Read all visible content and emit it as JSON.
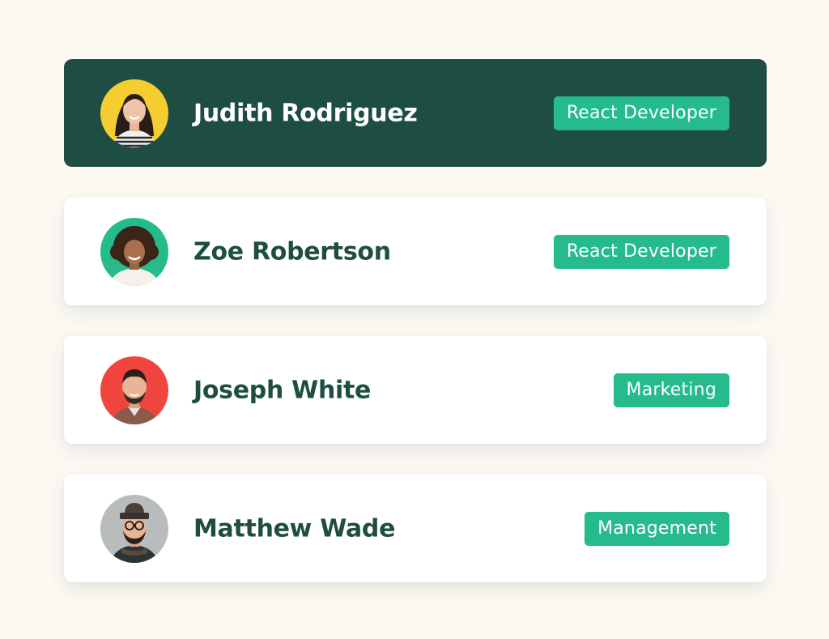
{
  "colors": {
    "background": "#fcf9f3",
    "active_card": "#1e4d42",
    "accent": "#25bb8c",
    "name_text": "#1e4d42"
  },
  "people": [
    {
      "name": "Judith Rodriguez",
      "role": "React Developer",
      "avatar_bg": "#f5cd30",
      "active": true
    },
    {
      "name": "Zoe Robertson",
      "role": "React Developer",
      "avatar_bg": "#25bb8c",
      "active": false
    },
    {
      "name": "Joseph White",
      "role": "Marketing",
      "avatar_bg": "#f0453e",
      "active": false
    },
    {
      "name": "Matthew Wade",
      "role": "Management",
      "avatar_bg": "#b9bcbd",
      "active": false
    }
  ]
}
